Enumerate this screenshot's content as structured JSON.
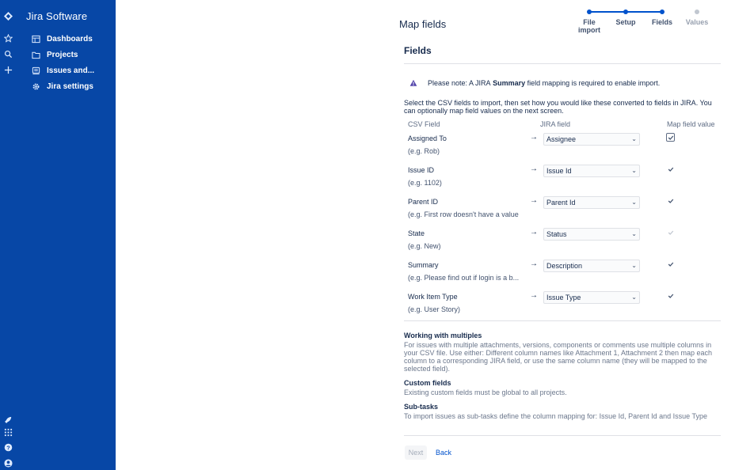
{
  "global_rail": {
    "icons": [
      "jira-logo-icon",
      "star-icon",
      "search-icon",
      "plus-icon",
      "rocket-icon",
      "apps-grid-icon",
      "help-icon",
      "profile-icon"
    ]
  },
  "sidebar": {
    "brand": "Jira Software",
    "items": [
      {
        "label": "Dashboards",
        "icon": "dashboard-icon"
      },
      {
        "label": "Projects",
        "icon": "folder-icon"
      },
      {
        "label": "Issues and...",
        "icon": "issues-icon"
      },
      {
        "label": "Jira settings",
        "icon": "gear-icon"
      }
    ]
  },
  "page": {
    "title": "Map fields"
  },
  "progress": {
    "steps": [
      {
        "label": "File import",
        "status": "done"
      },
      {
        "label": "Setup",
        "status": "done"
      },
      {
        "label": "Fields",
        "status": "current"
      },
      {
        "label": "Values",
        "status": "todo"
      }
    ]
  },
  "fields": {
    "title": "Fields",
    "note_prefix": "Please note: A JIRA",
    "note_bold": "Summary",
    "note_suffix": "field mapping is required to enable import.",
    "intro": "Select the CSV fields to import, then set how you would like these converted to fields in JIRA. You can optionally map field values on the next screen.",
    "columns": {
      "csv": "CSV Field",
      "jira": "JIRA field",
      "map": "Map field value"
    },
    "arrow": "→",
    "rows": [
      {
        "csv": "Assigned To",
        "example": "(e.g. Rob)",
        "jira": "Assignee",
        "map": true,
        "map_style": "boxed"
      },
      {
        "csv": "Issue ID",
        "example": "(e.g. 1102)",
        "jira": "Issue Id",
        "map": true,
        "map_style": "plain"
      },
      {
        "csv": "Parent ID",
        "example": "(e.g. First row doesn't have a value",
        "jira": "Parent Id",
        "map": true,
        "map_style": "plain"
      },
      {
        "csv": "State",
        "example": "(e.g. New)",
        "jira": "Status",
        "map": true,
        "map_style": "disabled"
      },
      {
        "csv": "Summary",
        "example": "(e.g. Please find out if login is a b...",
        "jira": "Description",
        "map": true,
        "map_style": "plain"
      },
      {
        "csv": "Work Item Type",
        "example": "(e.g. User Story)",
        "jira": "Issue Type",
        "map": true,
        "map_style": "plain"
      }
    ]
  },
  "info": {
    "multiples_title": "Working with multiples",
    "multiples_body": "For issues with multiple attachments, versions, components or comments use multiple columns in your CSV file. Use either: Different column names like Attachment 1, Attachment 2 then map each column to a corresponding JIRA field, or use the same column name (they will be mapped to the selected field).",
    "custom_title": "Custom fields",
    "custom_body": "Existing custom fields must be global to all projects.",
    "subtasks_title": "Sub-tasks",
    "subtasks_body": "To import issues as sub-tasks define the column mapping for: Issue Id, Parent Id and Issue Type"
  },
  "actions": {
    "next": "Next",
    "back": "Back"
  },
  "colors": {
    "nav_bg": "#0747a6",
    "primary": "#0052cc",
    "warning": "#5243aa"
  }
}
